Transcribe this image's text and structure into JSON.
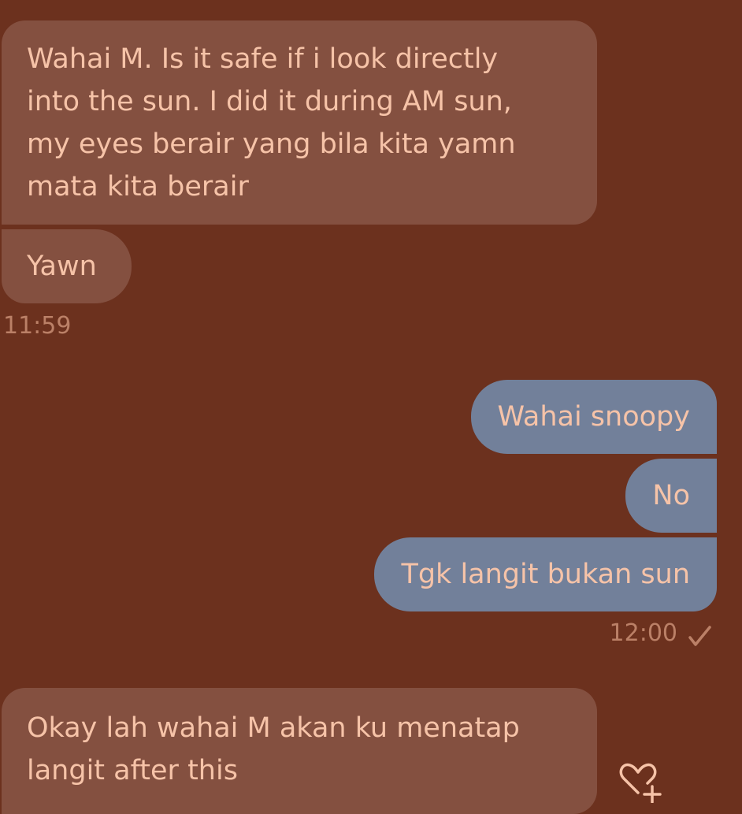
{
  "messages": [
    {
      "direction": "incoming",
      "text": "Wahai M. Is it safe if i look directly\ninto the sun. I did it during AM sun,\nmy eyes berair yang bila kita yamn\nmata kita berair"
    },
    {
      "direction": "incoming",
      "text": "Yawn"
    },
    {
      "direction": "outgoing",
      "text": "Wahai snoopy"
    },
    {
      "direction": "outgoing",
      "text": "No"
    },
    {
      "direction": "outgoing",
      "text": "Tgk langit bukan sun"
    },
    {
      "direction": "incoming",
      "text": "Okay lah wahai M akan ku menatap\nlangit after this"
    }
  ],
  "timestamps": {
    "incoming_group": "11:59",
    "outgoing_group": "12:00"
  },
  "status": {
    "delivered_icon": "checkmark-icon"
  },
  "reaction": {
    "icon": "heart-plus-icon"
  },
  "colors": {
    "background": "#6c311e",
    "incoming_bubble": "#845040",
    "outgoing_bubble": "#72809a",
    "message_text": "#f6c3a8",
    "timestamp_text": "#bb8067"
  }
}
